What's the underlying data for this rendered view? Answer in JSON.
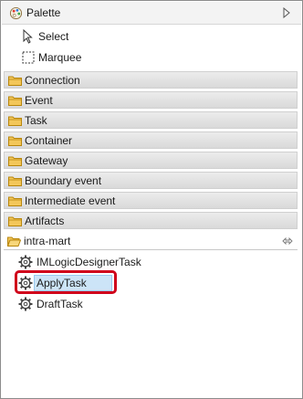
{
  "palette": {
    "title": "Palette",
    "icon": "palette-icon",
    "collapse_icon": "collapse-triangle-icon"
  },
  "tools": [
    {
      "label": "Select",
      "icon": "select-arrow-icon"
    },
    {
      "label": "Marquee",
      "icon": "marquee-icon"
    }
  ],
  "drawers": [
    {
      "label": "Connection"
    },
    {
      "label": "Event"
    },
    {
      "label": "Task"
    },
    {
      "label": "Container"
    },
    {
      "label": "Gateway"
    },
    {
      "label": "Boundary event"
    },
    {
      "label": "Intermediate event"
    },
    {
      "label": "Artifacts"
    }
  ],
  "open_drawer": {
    "label": "intra-mart",
    "pin_icon": "pin-icon",
    "items": [
      {
        "label": "IMLogicDesignerTask",
        "icon": "gear-icon"
      },
      {
        "label": "ApplyTask",
        "icon": "gear-icon",
        "selected": true
      },
      {
        "label": "DraftTask",
        "icon": "gear-icon"
      }
    ]
  },
  "colors": {
    "highlight_border": "#d0021b",
    "selection_fill": "#cce4f7",
    "folder": "#e8b84a"
  }
}
